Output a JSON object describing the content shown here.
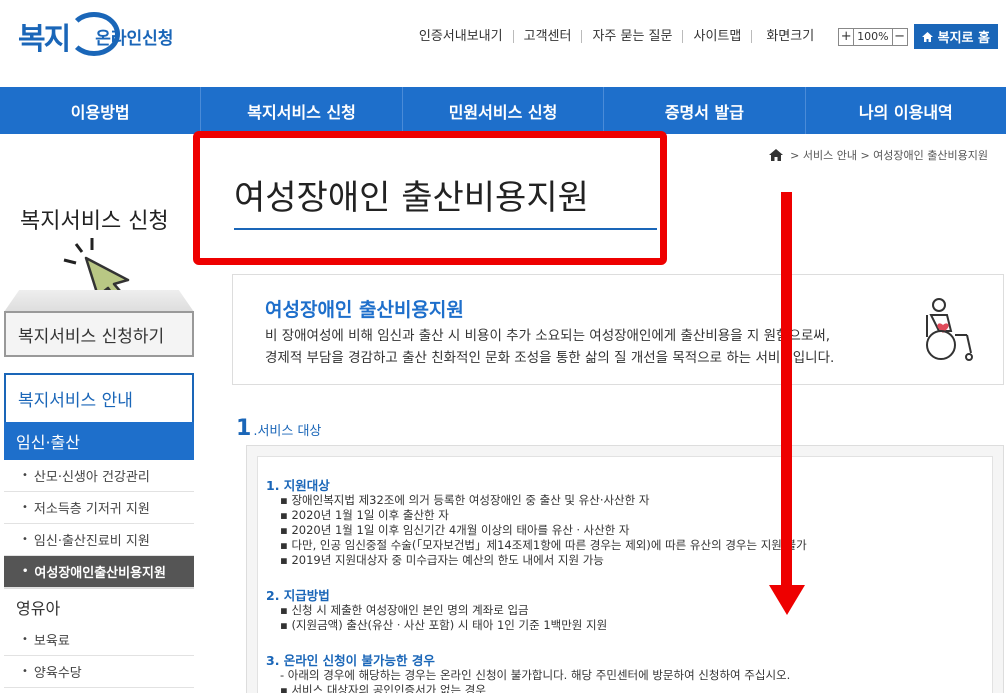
{
  "header": {
    "logo_text": "복지",
    "logo_sub": "온라인신청",
    "util_links": [
      "인증서내보내기",
      "고객센터",
      "자주 묻는 질문",
      "사이트맵"
    ],
    "zoom_label": "화면크기",
    "zoom_plus": "+",
    "zoom_value": "100%",
    "zoom_minus": "−",
    "home_button": "복지로 홈"
  },
  "gnb": [
    "이용방법",
    "복지서비스 신청",
    "민원서비스 신청",
    "증명서 발급",
    "나의 이용내역"
  ],
  "sidebar": {
    "title": "복지서비스 신청",
    "apply_label": "복지서비스 신청하기",
    "guide_label": "복지서비스 안내",
    "cat_active": "임신·출산",
    "sub_items": [
      "산모·신생아 건강관리",
      "저소득층 기저귀 지원",
      "임신·출산진료비 지원",
      "여성장애인출산비용지원"
    ],
    "cat_next": "영유아",
    "sub_items_2": [
      "보육료",
      "양육수당"
    ]
  },
  "breadcrumb": [
    "서비스 안내",
    "여성장애인 출산비용지원"
  ],
  "page_title": "여성장애인 출산비용지원",
  "intro": {
    "title": "여성장애인 출산비용지원",
    "desc_1": "비 장애여성에 비해 임신과 출산 시 비용이 추가 소요되는 여성장애인에게 출산비용을 지  원함으로써,",
    "desc_2": "경제적 부담을 경감하고 출산 친화적인 문화 조성을 통한 삶의 질 개선을 목적으로 하는 서비스입니다."
  },
  "section": {
    "num": "1",
    "label": ".서비스 대상"
  },
  "groups": [
    {
      "title": "1.  지원대상",
      "lines": [
        "▪ 장애인복지법 제32조에 의거 등록한 여성장애인 중 출산 및 유산·사산한 자",
        "▪ 2020년 1월 1일 이후 출산한 자",
        "▪ 2020년 1월 1일 이후 임신기간 4개월 이상의 태아를 유산ㆍ사산한 자",
        "▪ 다만, 인공 임신중절 수술(「모자보건법」제14조제1항에 따른 경우는 제외)에 따른 유산의 경우는 지원 불가",
        "▪ 2019년 지원대상자 중 미수급자는 예산의 한도 내에서 지원 가능"
      ]
    },
    {
      "title": "2.  지급방법",
      "lines": [
        "▪ 신청 시 제출한 여성장애인 본인 명의 계좌로 입금",
        "▪ (지원금액) 출산(유산ㆍ사산 포함) 시 태아 1인 기준 1백만원 지원"
      ]
    },
    {
      "title": "3.  온라인 신청이 불가능한 경우",
      "lines": [
        " - 아래의 경우에 해당하는 경우는 온라인 신청이 불가합니다. 해당 주민센터에 방문하여 신청하여 주십시오.",
        "▪ 서비스 대상자의 공인인증서가 없는 경우"
      ]
    }
  ],
  "colors": {
    "brand_blue": "#1e6fcb",
    "annotation_red": "#ee0000"
  }
}
